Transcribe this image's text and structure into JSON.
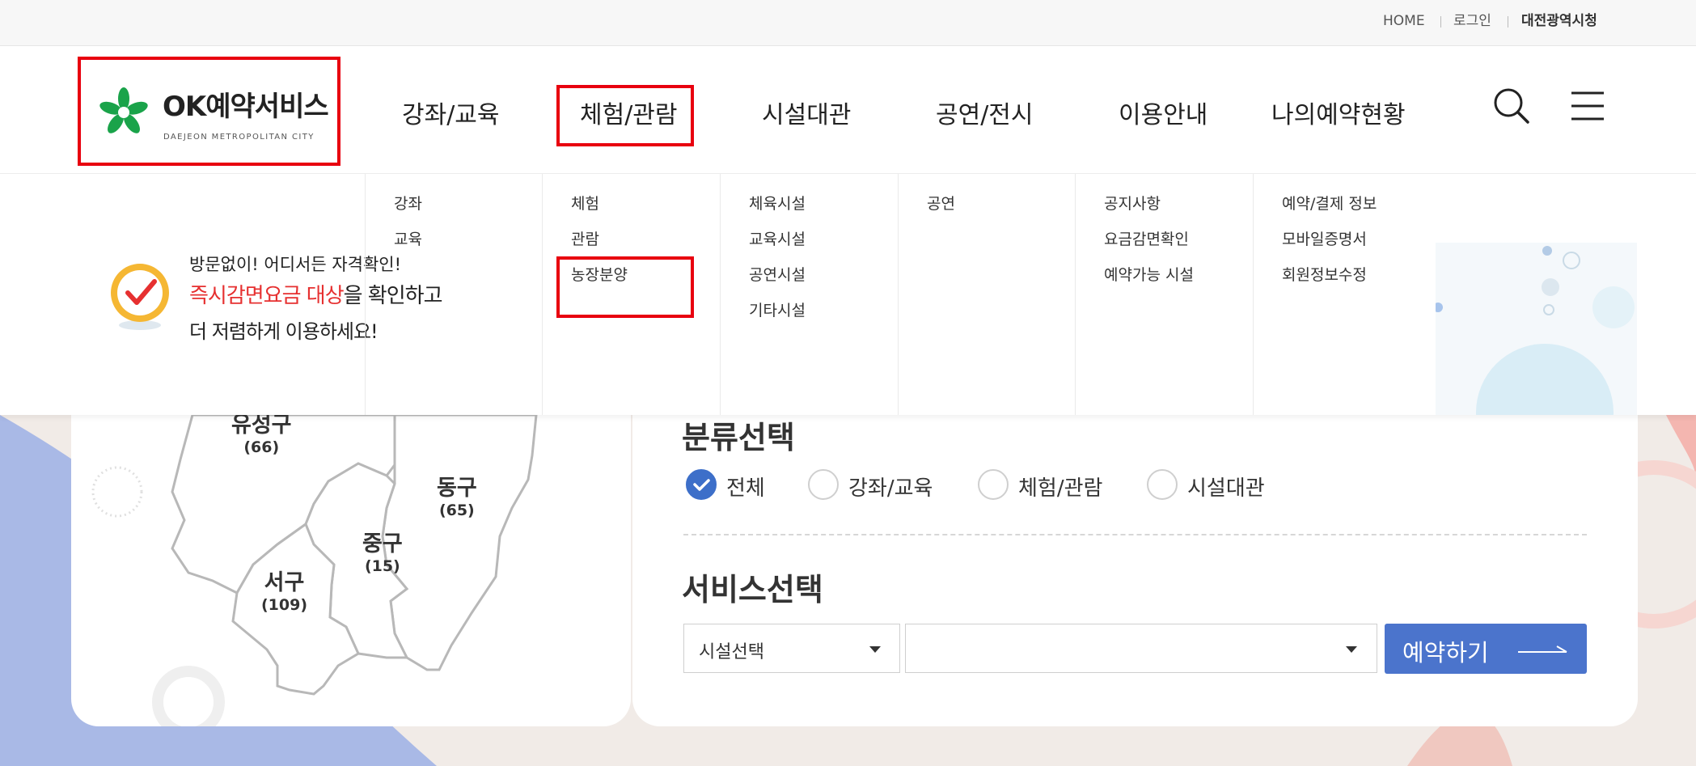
{
  "utility": {
    "home": "HOME",
    "login": "로그인",
    "city": "대전광역시청"
  },
  "logo": {
    "brand": "OK예약서비스",
    "sub": "DAEJEON METROPOLITAN CITY"
  },
  "nav": [
    "강좌/교육",
    "체험/관람",
    "시설대관",
    "공연/전시",
    "이용안내",
    "나의예약현황"
  ],
  "submenu": [
    [
      "강좌",
      "교육"
    ],
    [
      "체험",
      "관람",
      "농장분양"
    ],
    [
      "체육시설",
      "교육시설",
      "공연시설",
      "기타시설"
    ],
    [
      "공연"
    ],
    [
      "공지사항",
      "요금감면확인",
      "예약가능 시설"
    ],
    [
      "예약/결제 정보",
      "모바일증명서",
      "회원정보수정"
    ]
  ],
  "promo": {
    "line1": "방문없이! 어디서든 자격확인!",
    "highlight": "즉시감면요금 대상",
    "line2_rest": "을 확인하고",
    "line3": "더 저렴하게 이용하세요!"
  },
  "map": {
    "districts": [
      {
        "name": "유성구",
        "count": "(66)"
      },
      {
        "name": "동구",
        "count": "(65)"
      },
      {
        "name": "중구",
        "count": "(15)"
      },
      {
        "name": "서구",
        "count": "(109)"
      }
    ]
  },
  "form": {
    "category_title": "분류선택",
    "categories": [
      {
        "label": "전체",
        "selected": true
      },
      {
        "label": "강좌/교육",
        "selected": false
      },
      {
        "label": "체험/관람",
        "selected": false
      },
      {
        "label": "시설대관",
        "selected": false
      }
    ],
    "service_title": "서비스선택",
    "facility_select": "시설선택",
    "detail_select": "",
    "reserve_button": "예약하기"
  },
  "colors": {
    "accent": "#4b74cc",
    "highlight_box": "#e8000f",
    "promo_red": "#e63030",
    "logo_green": "#1aa34a"
  }
}
